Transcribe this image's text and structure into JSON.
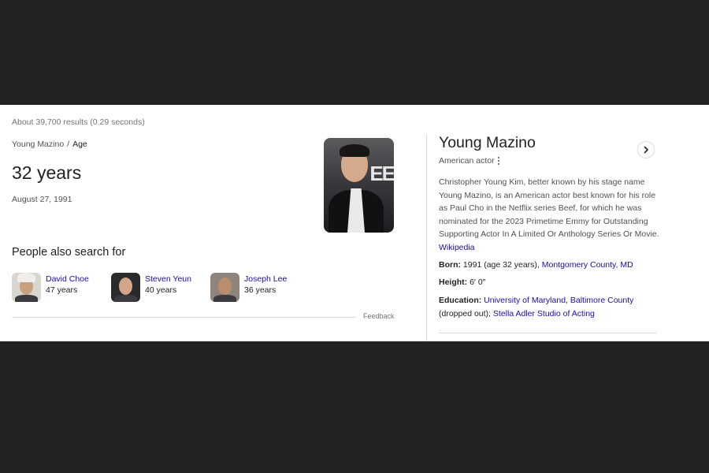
{
  "results": {
    "count_text": "About 39,700 results (0.29 seconds)"
  },
  "answer": {
    "breadcrumb_entity": "Young Mazino",
    "breadcrumb_sep": "/",
    "breadcrumb_attribute": "Age",
    "value": "32 years",
    "date": "August 27, 1991"
  },
  "hero_photo": {
    "bg_text": "EE"
  },
  "people_also_search": {
    "title": "People also search for",
    "items": [
      {
        "name": "David Choe",
        "age": "47 years"
      },
      {
        "name": "Steven Yeun",
        "age": "40 years"
      },
      {
        "name": "Joseph Lee",
        "age": "36 years"
      }
    ]
  },
  "feedback": "Feedback",
  "knowledge_panel": {
    "title": "Young Mazino",
    "subtitle": "American actor",
    "description": "Christopher Young Kim, better known by his stage name Young Mazino, is an American actor best known for his role as Paul Cho in the Netflix series Beef, for which he was nominated for the 2023 Primetime Emmy for Outstanding Supporting Actor In A Limited Or Anthology Series Or Movie.",
    "source_link": "Wikipedia",
    "facts": {
      "born": {
        "label": "Born:",
        "text": "1991 (age 32 years),",
        "link": "Montgomery County, MD"
      },
      "height": {
        "label": "Height:",
        "text": "6′ 0″"
      },
      "education": {
        "label": "Education:",
        "link1": "University of Maryland, Baltimore County",
        "text": "(dropped out);",
        "link2": "Stella Adler Studio of Acting"
      }
    }
  },
  "colors": {
    "link": "#1a0dab",
    "backdrop": "#232124",
    "panel": "#ffffff"
  }
}
